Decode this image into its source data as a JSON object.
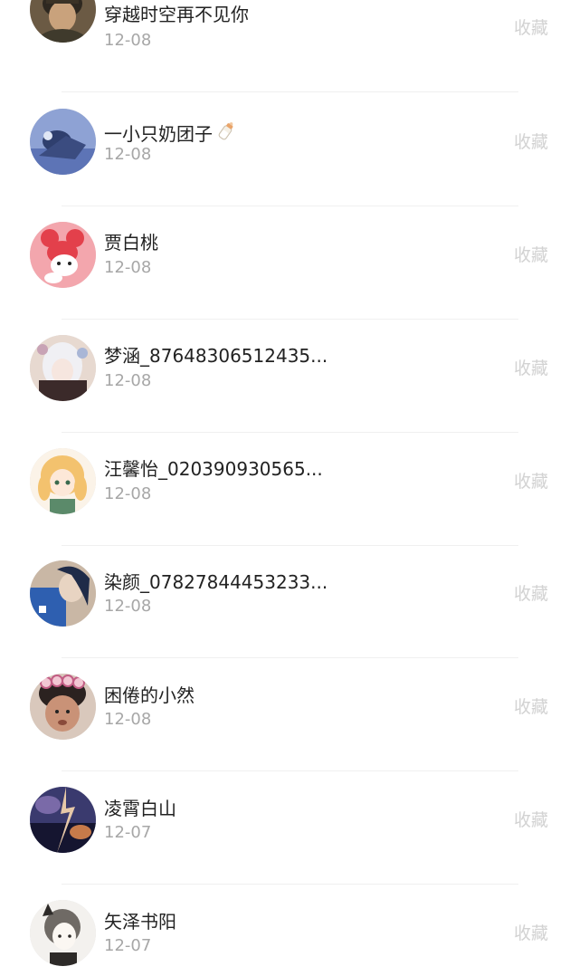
{
  "fans": [
    {
      "name": "穿越时空再不见你",
      "date": "12-08",
      "action": "收藏",
      "avatar_colors": [
        "#5a4a36",
        "#3a3226",
        "#c9a27c"
      ]
    },
    {
      "name": "一小只奶团子",
      "name_emoji": "baby-bottle-icon",
      "date": "12-08",
      "action": "收藏",
      "avatar_colors": [
        "#5d74b6",
        "#8ea2d4",
        "#2f3f6e"
      ]
    },
    {
      "name": "贾白桃",
      "date": "12-08",
      "action": "收藏",
      "avatar_colors": [
        "#f3a6ad",
        "#e3404b",
        "#ffffff"
      ]
    },
    {
      "name": "梦涵_87648306512435...",
      "date": "12-08",
      "action": "收藏",
      "avatar_colors": [
        "#e7d9d0",
        "#3b2a2a",
        "#f0f0f4"
      ]
    },
    {
      "name": "汪馨怡_020390930565...",
      "date": "12-08",
      "action": "收藏",
      "avatar_colors": [
        "#fbf3e8",
        "#f3c26e",
        "#5b8a6a"
      ]
    },
    {
      "name": "染颜_07827844453233...",
      "date": "12-08",
      "action": "收藏",
      "avatar_colors": [
        "#2e5fb0",
        "#c9b7a5",
        "#1f2b48"
      ]
    },
    {
      "name": "困倦的小然",
      "date": "12-08",
      "action": "收藏",
      "avatar_colors": [
        "#2b2220",
        "#c99277",
        "#f2c7d3"
      ]
    },
    {
      "name": "凌霄白山",
      "date": "12-07",
      "action": "收藏",
      "avatar_colors": [
        "#3a3a6e",
        "#c77a4a",
        "#151530"
      ]
    },
    {
      "name": "矢泽书阳",
      "date": "12-07",
      "action": "收藏",
      "avatar_colors": [
        "#f3f1ee",
        "#6f6a65",
        "#2d2a28"
      ]
    }
  ]
}
